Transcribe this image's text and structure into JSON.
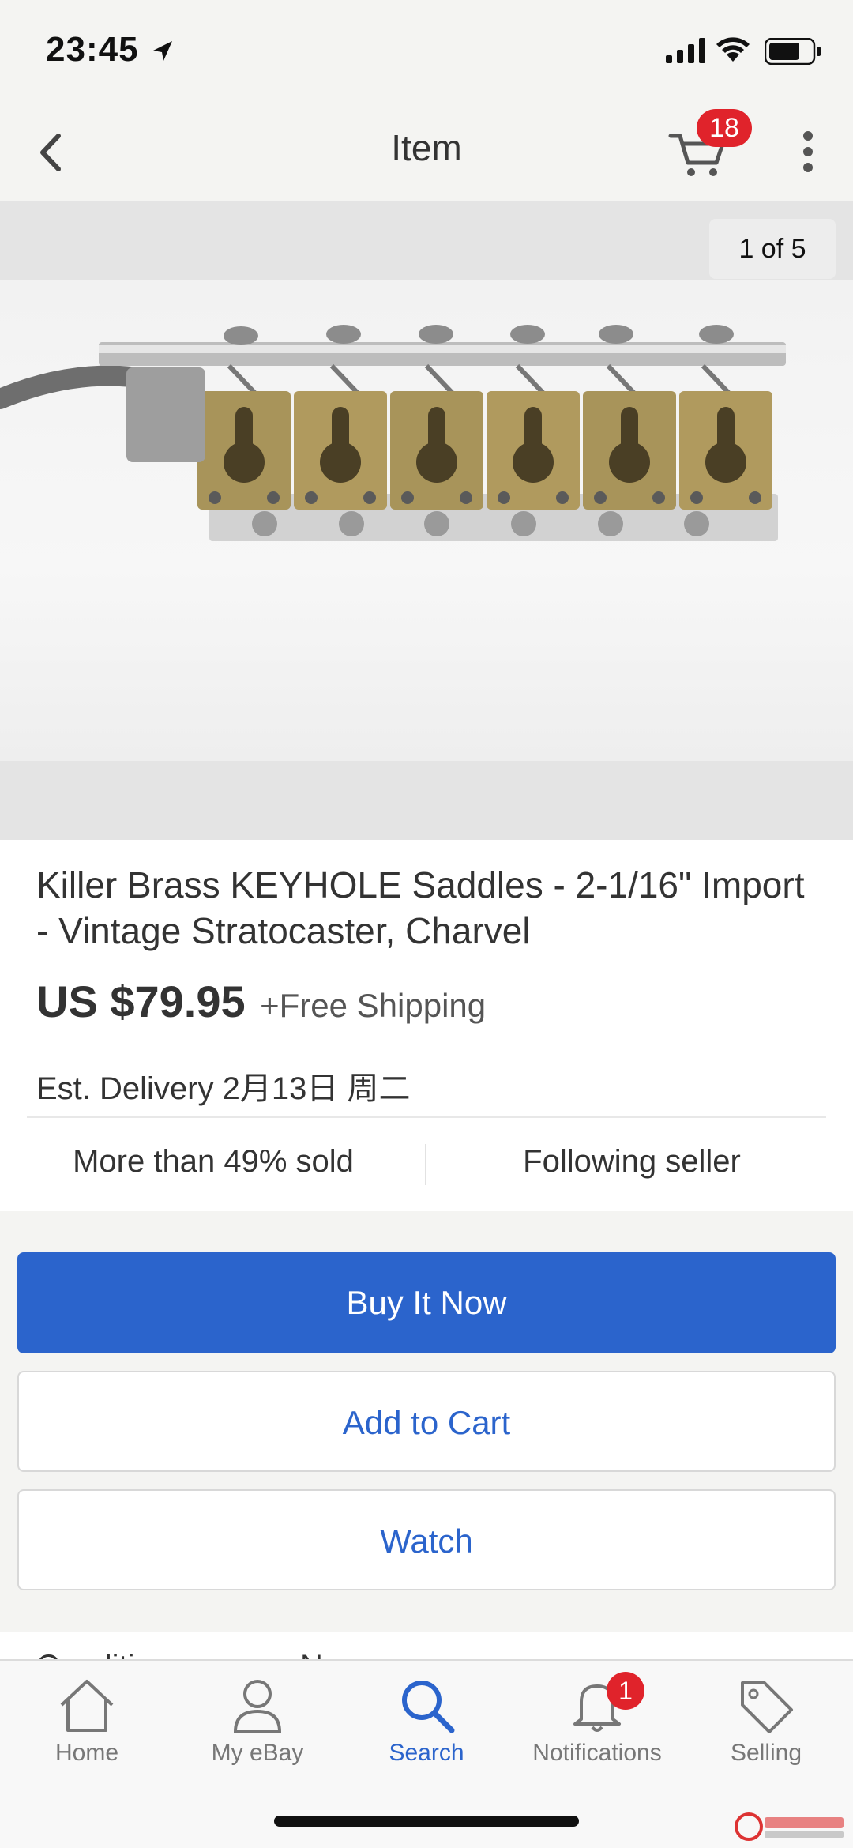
{
  "status_bar": {
    "time": "23:45"
  },
  "header": {
    "title": "Item",
    "cart_count": "18"
  },
  "gallery": {
    "counter": "1 of 5",
    "image_alt": "Brass keyhole saddles on tremolo bridge"
  },
  "item": {
    "title": "Killer Brass KEYHOLE Saddles - 2-1/16\" Import - Vintage Stratocaster, Charvel",
    "price": "US $79.95",
    "shipping": "+Free Shipping",
    "delivery": "Est. Delivery 2月13日 周二",
    "sold_stat": "More than 49% sold",
    "seller_stat": "Following seller"
  },
  "actions": {
    "buy_now": "Buy It Now",
    "add_to_cart": "Add to Cart",
    "watch": "Watch"
  },
  "condition_peek": {
    "label": "Conditi",
    "value": "N"
  },
  "tabs": [
    {
      "label": "Home",
      "icon": "home-icon"
    },
    {
      "label": "My eBay",
      "icon": "person-icon"
    },
    {
      "label": "Search",
      "icon": "search-icon",
      "active": true
    },
    {
      "label": "Notifications",
      "icon": "bell-icon",
      "badge": "1"
    },
    {
      "label": "Selling",
      "icon": "tag-icon"
    }
  ],
  "colors": {
    "accent": "#2b64cc",
    "badge": "#e0232b"
  }
}
